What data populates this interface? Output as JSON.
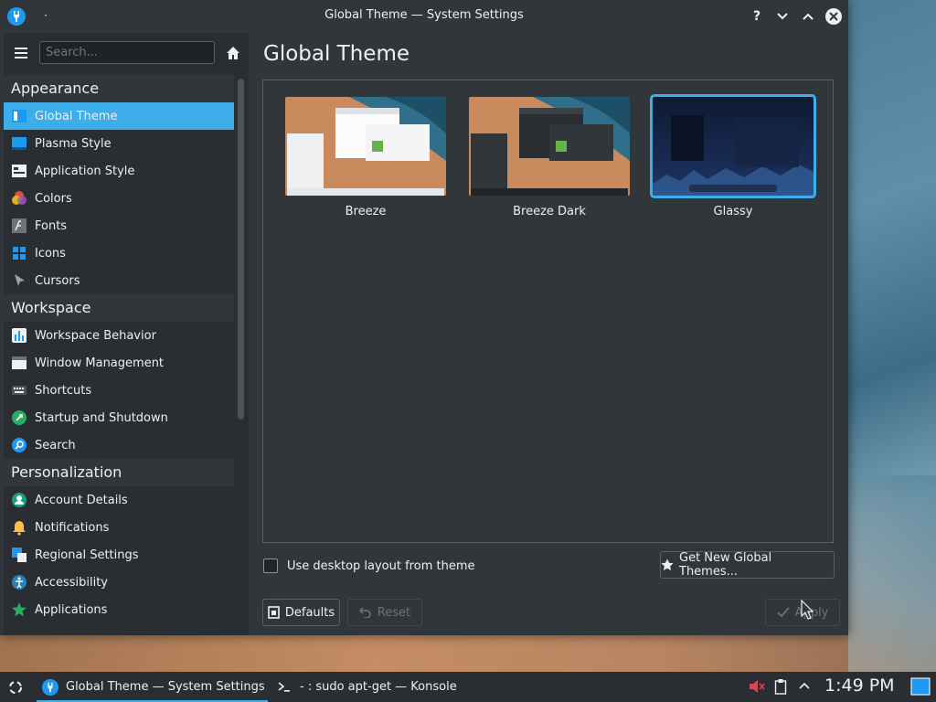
{
  "window": {
    "title": "Global Theme — System Settings",
    "pin_glyph": "·"
  },
  "sidebar": {
    "search_placeholder": "Search...",
    "categories": [
      {
        "label": "Appearance",
        "items": [
          {
            "label": "Global Theme",
            "icon": "global-theme-icon",
            "active": true
          },
          {
            "label": "Plasma Style",
            "icon": "plasma-style-icon"
          },
          {
            "label": "Application Style",
            "icon": "application-style-icon"
          },
          {
            "label": "Colors",
            "icon": "colors-icon"
          },
          {
            "label": "Fonts",
            "icon": "fonts-icon"
          },
          {
            "label": "Icons",
            "icon": "icons-icon"
          },
          {
            "label": "Cursors",
            "icon": "cursors-icon"
          }
        ]
      },
      {
        "label": "Workspace",
        "items": [
          {
            "label": "Workspace Behavior",
            "icon": "workspace-behavior-icon"
          },
          {
            "label": "Window Management",
            "icon": "window-management-icon"
          },
          {
            "label": "Shortcuts",
            "icon": "keyboard-icon"
          },
          {
            "label": "Startup and Shutdown",
            "icon": "startup-icon"
          },
          {
            "label": "Search",
            "icon": "search-icon"
          }
        ]
      },
      {
        "label": "Personalization",
        "items": [
          {
            "label": "Account Details",
            "icon": "account-icon"
          },
          {
            "label": "Notifications",
            "icon": "bell-icon"
          },
          {
            "label": "Regional Settings",
            "icon": "regional-icon"
          },
          {
            "label": "Accessibility",
            "icon": "accessibility-icon"
          },
          {
            "label": "Applications",
            "icon": "applications-icon"
          }
        ]
      }
    ]
  },
  "main": {
    "title": "Global Theme",
    "themes": [
      {
        "label": "Breeze",
        "style": "light",
        "selected": false
      },
      {
        "label": "Breeze Dark",
        "style": "dark",
        "selected": false
      },
      {
        "label": "Glassy",
        "style": "glassy",
        "selected": true
      }
    ],
    "use_layout_label": "Use desktop layout from theme",
    "use_layout_checked": false,
    "get_new_label": "Get New Global Themes...",
    "defaults_label": "Defaults",
    "reset_label": "Reset",
    "apply_label": "Apply"
  },
  "taskbar": {
    "tasks": [
      {
        "label": "Global Theme  — System Settings",
        "icon": "system-settings-icon",
        "active": true
      },
      {
        "label": "- : sudo apt-get — Konsole",
        "icon": "konsole-icon",
        "active": false
      }
    ],
    "clock": "1:49 PM"
  },
  "colors": {
    "accent": "#3daee9",
    "window_bg": "#31363b",
    "sidebar_bg": "#2a2e32"
  }
}
